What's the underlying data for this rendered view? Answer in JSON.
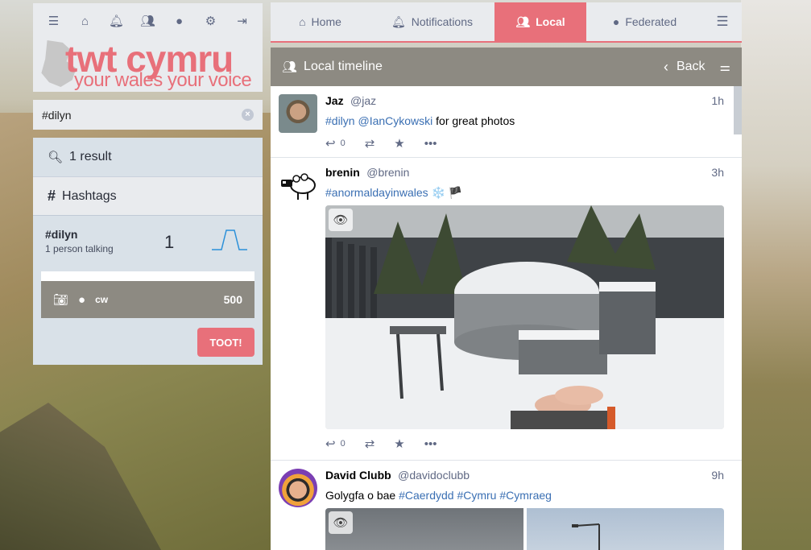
{
  "left": {
    "top_icons": [
      "menu-icon",
      "home-icon",
      "bell-icon",
      "users-icon",
      "globe-icon",
      "gear-icon",
      "logout-icon"
    ],
    "logo": {
      "main": "twt cymru",
      "sub": "your wales your voice"
    },
    "search": {
      "value": "#dilyn"
    },
    "results": {
      "count_label": "1 result",
      "hashtags_label": "Hashtags"
    },
    "hashtag": {
      "tag": "#dilyn",
      "talking": "1 person talking",
      "count": "1"
    },
    "compose": {
      "cw": "cw",
      "chars": "500",
      "toot": "TOOT!"
    }
  },
  "tabs": [
    {
      "label": "Home",
      "icon": "home-icon"
    },
    {
      "label": "Notifications",
      "icon": "bell-icon"
    },
    {
      "label": "Local",
      "icon": "users-icon",
      "active": true
    },
    {
      "label": "Federated",
      "icon": "globe-icon"
    }
  ],
  "timeline": {
    "title": "Local timeline",
    "back": "Back"
  },
  "statuses": [
    {
      "display_name": "Jaz",
      "acct": "@jaz",
      "time": "1h",
      "hashtag": "#dilyn",
      "mention": "@IanCykowski",
      "text": " for great photos",
      "replies": "0"
    },
    {
      "display_name": "brenin",
      "acct": "@brenin",
      "time": "3h",
      "hashtag": "#anormaldayinwales",
      "emoji": "❄️ 🏴",
      "replies": "0"
    },
    {
      "display_name": "David Clubb",
      "acct": "@davidoclubb",
      "time": "9h",
      "text": "Golygfa o bae ",
      "tags": [
        "#Caerdydd",
        "#Cymru",
        "#Cymraeg"
      ]
    }
  ],
  "colors": {
    "accent": "#e8707a",
    "link": "#3a6fb3",
    "panel": "#d9e1e8",
    "header": "#8d8a82"
  }
}
